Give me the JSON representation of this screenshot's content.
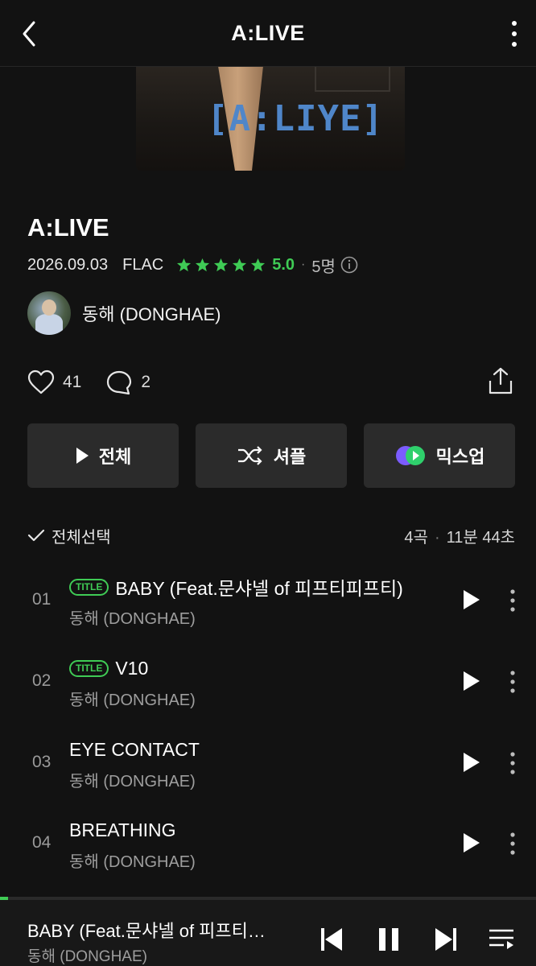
{
  "header": {
    "title": "A:LIVE"
  },
  "album_art": {
    "logo_text": "[A:LIYE]"
  },
  "album": {
    "title": "A:LIVE",
    "date": "2026.09.03",
    "format": "FLAC",
    "rating": "5.0",
    "rating_stars": 5,
    "rater_count": "5명",
    "artist": "동해 (DONGHAE)"
  },
  "social": {
    "likes": "41",
    "comments": "2"
  },
  "actions": {
    "play_all": "전체",
    "shuffle": "셔플",
    "mixup": "믹스업"
  },
  "list_header": {
    "select_all": "전체선택",
    "track_count": "4곡",
    "total_time": "11분 44초"
  },
  "tracks": [
    {
      "num": "01",
      "badge": "TITLE",
      "title": "BABY (Feat.문샤넬 of 피프티피프티)",
      "artist": "동해 (DONGHAE)"
    },
    {
      "num": "02",
      "badge": "TITLE",
      "title": "V10",
      "artist": "동해 (DONGHAE)"
    },
    {
      "num": "03",
      "badge": "",
      "title": "EYE CONTACT",
      "artist": "동해 (DONGHAE)"
    },
    {
      "num": "04",
      "badge": "",
      "title": "BREATHING",
      "artist": "동해 (DONGHAE)"
    }
  ],
  "now_playing": {
    "title": "BABY (Feat.문샤넬 of 피프티…",
    "artist": "동해 (DONGHAE)",
    "progress": 0.015
  },
  "colors": {
    "accent": "#3fcb55",
    "background": "#121212",
    "button": "#2b2b2b"
  }
}
